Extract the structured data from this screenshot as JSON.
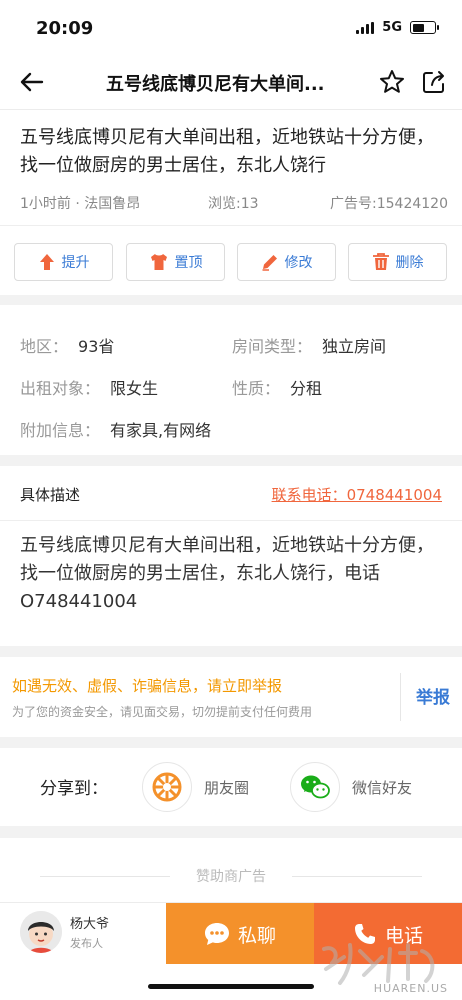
{
  "status_bar": {
    "time": "20:09",
    "network": "5G"
  },
  "nav": {
    "title": "五号线底博贝尼有大单间..."
  },
  "post": {
    "title": "五号线底博贝尼有大单间出租，近地铁站十分方便，找一位做厨房的男士居住，东北人饶行",
    "time_location": "1小时前 · 法国鲁昂",
    "views": "浏览:13",
    "ad_number": "广告号:15424120"
  },
  "actions": [
    {
      "label": "提升",
      "icon": "arrow-up-icon"
    },
    {
      "label": "置顶",
      "icon": "shirt-icon"
    },
    {
      "label": "修改",
      "icon": "pencil-icon"
    },
    {
      "label": "删除",
      "icon": "trash-icon"
    }
  ],
  "attributes": {
    "region": {
      "key": "地区：",
      "value": "93省"
    },
    "room_type": {
      "key": "房间类型：",
      "value": "独立房间"
    },
    "tenant": {
      "key": "出租对象：",
      "value": "限女生"
    },
    "nature": {
      "key": "性质：",
      "value": "分租"
    },
    "extra": {
      "key": "附加信息：",
      "value": "有家具,有网络"
    }
  },
  "description": {
    "label": "具体描述",
    "contact": "联系电话：0748441004",
    "body": "五号线底博贝尼有大单间出租，近地铁站十分方便，找一位做厨房的男士居住，东北人饶行，电话O748441004"
  },
  "warning": {
    "title": "如遇无效、虚假、诈骗信息，请立即举报",
    "subtitle": "为了您的资金安全，请见面交易，切勿提前支付任何费用",
    "report": "举报"
  },
  "share": {
    "label": "分享到：",
    "moments": "朋友圈",
    "wechat": "微信好友"
  },
  "sponsor": {
    "label": "赞助商广告"
  },
  "bottom_bar": {
    "poster_name": "杨大爷",
    "poster_role": "发布人",
    "chat": "私聊",
    "call": "电话"
  },
  "watermark": {
    "text": "HUAREN.US"
  },
  "colors": {
    "accent_blue": "#3a7bd5",
    "warn_orange": "#f39800",
    "chat_orange": "#f4912b",
    "call_orange": "#f36b33",
    "wechat_green": "#1aad19"
  }
}
